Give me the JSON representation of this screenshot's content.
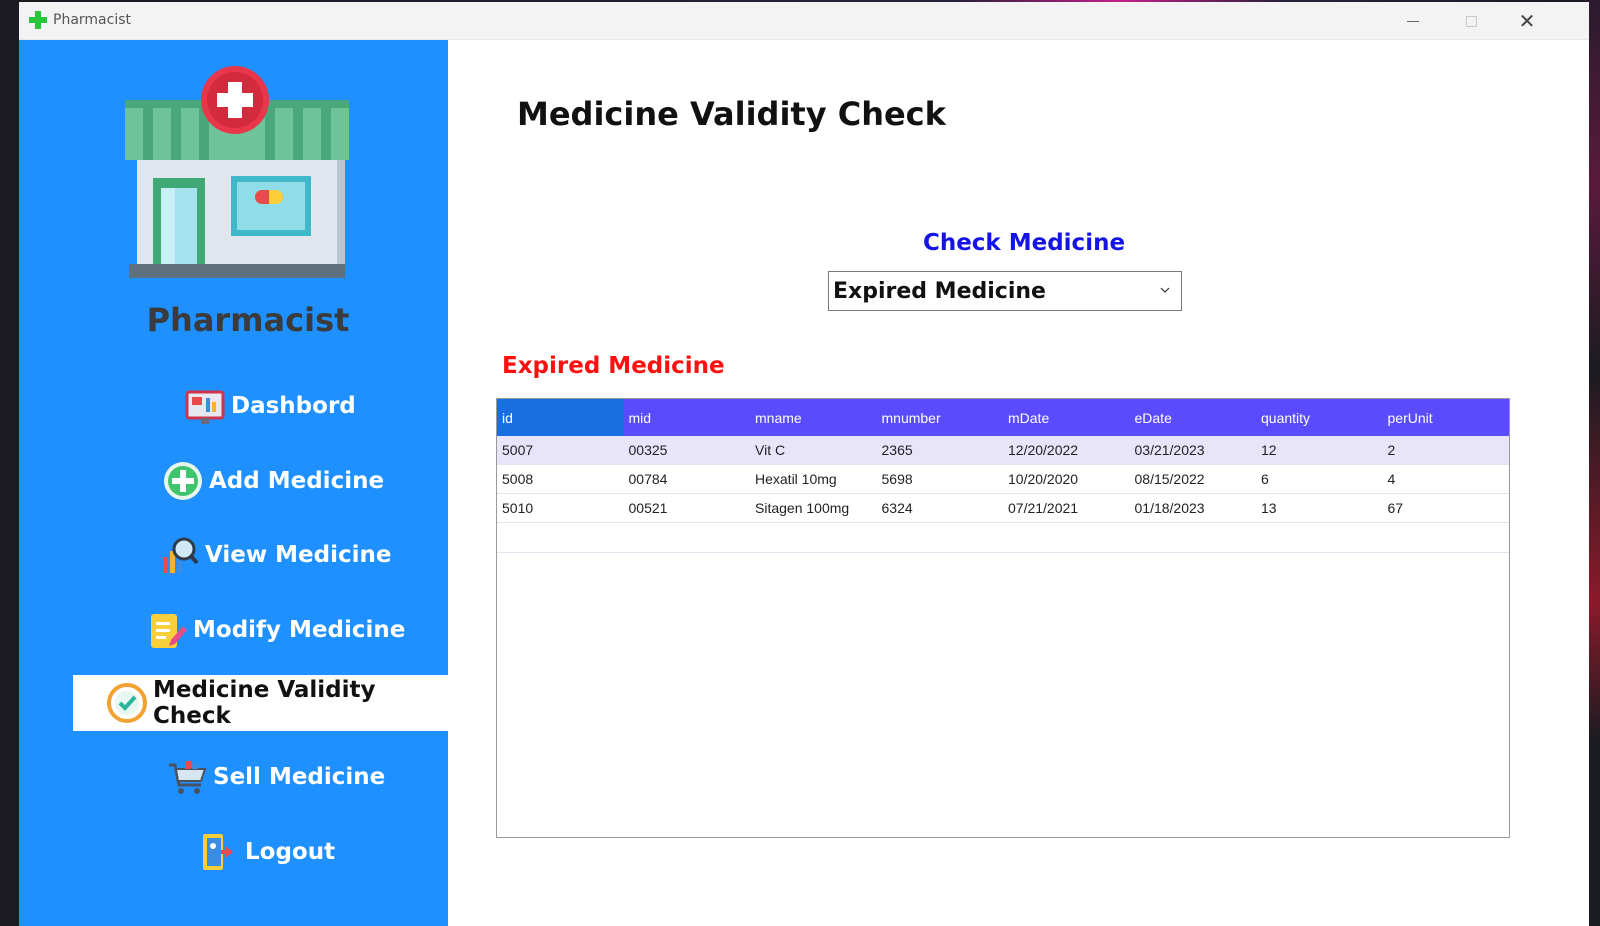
{
  "window": {
    "title": "Pharmacist"
  },
  "sidebar": {
    "brand": "Pharmacist",
    "items": [
      {
        "label": "Dashbord",
        "icon": "dashboard-icon"
      },
      {
        "label": "Add Medicine",
        "icon": "add-circle-icon"
      },
      {
        "label": "View Medicine",
        "icon": "magnifier-chart-icon"
      },
      {
        "label": "Modify Medicine",
        "icon": "edit-note-icon"
      },
      {
        "label": "Medicine Validity Check",
        "icon": "check-circle-icon",
        "active": true
      },
      {
        "label": "Sell Medicine",
        "icon": "cart-icon"
      },
      {
        "label": "Logout",
        "icon": "logout-icon"
      }
    ]
  },
  "main": {
    "title": "Medicine Validity Check",
    "check_label": "Check Medicine",
    "dropdown_value": "Expired Medicine",
    "section_label": "Expired Medicine",
    "table": {
      "columns": [
        "id",
        "mid",
        "mname",
        "mnumber",
        "mDate",
        "eDate",
        "quantity",
        "perUnit"
      ],
      "rows": [
        [
          "5007",
          "00325",
          "Vit C",
          "2365",
          "12/20/2022",
          "03/21/2023",
          "12",
          "2"
        ],
        [
          "5008",
          "00784",
          "Hexatil 10mg",
          "5698",
          "10/20/2020",
          "08/15/2022",
          "6",
          "4"
        ],
        [
          "5010",
          "00521",
          "Sitagen 100mg",
          "6324",
          "07/21/2021",
          "01/18/2023",
          "13",
          "67"
        ]
      ]
    }
  },
  "colors": {
    "sidebar_bg": "#1e90ff",
    "header_bg": "#5a4bff",
    "check_label": "#1414e6",
    "section_label": "#ff1010"
  }
}
